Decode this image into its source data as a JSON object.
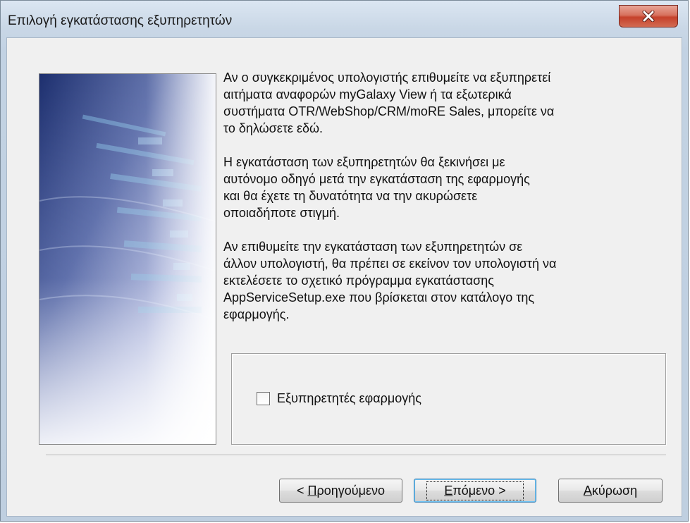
{
  "window": {
    "title": "Επιλογή εγκατάστασης εξυπηρετητών"
  },
  "content": {
    "paragraphs": [
      "Αν ο συγκεκριμένος υπολογιστής επιθυμείτε να εξυπηρετεί\nαιτήματα αναφορών myGalaxy View ή τα εξωτερικά\nσυστήματα OTR/WebShop/CRM/moRE Sales, μπορείτε να\nτο δηλώσετε εδώ.",
      "Η εγκατάσταση των εξυπηρετητών θα ξεκινήσει με\nαυτόνομο οδηγό μετά την εγκατάσταση της εφαρμογής\nκαι θα έχετε τη δυνατότητα να την ακυρώσετε\nοποιαδήποτε στιγμή.",
      "Αν επιθυμείτε την εγκατάσταση των εξυπηρετητών σε\nάλλον υπολογιστή, θα πρέπει σε εκείνον τον υπολογιστή να\nεκτελέσετε το σχετικό πρόγραμμα εγκατάστασης\nAppServiceSetup.exe που βρίσκεται στον κατάλογο της\nεφαρμογής."
    ]
  },
  "options": {
    "app_servers_label": "Εξυπηρετητές εφαρμογής",
    "app_servers_checked": false
  },
  "buttons": {
    "back_label_mnemonic": "Π",
    "back_label_rest": "ροηγούμενο",
    "back_prefix": "< ",
    "next_label_mnemonic": "Ε",
    "next_label_rest": "πόμενο",
    "next_suffix": " >",
    "cancel_label_mnemonic": "Α",
    "cancel_label_rest": "κύρωση"
  },
  "icons": {
    "close": "close-icon",
    "checkbox": "checkbox-unchecked"
  }
}
